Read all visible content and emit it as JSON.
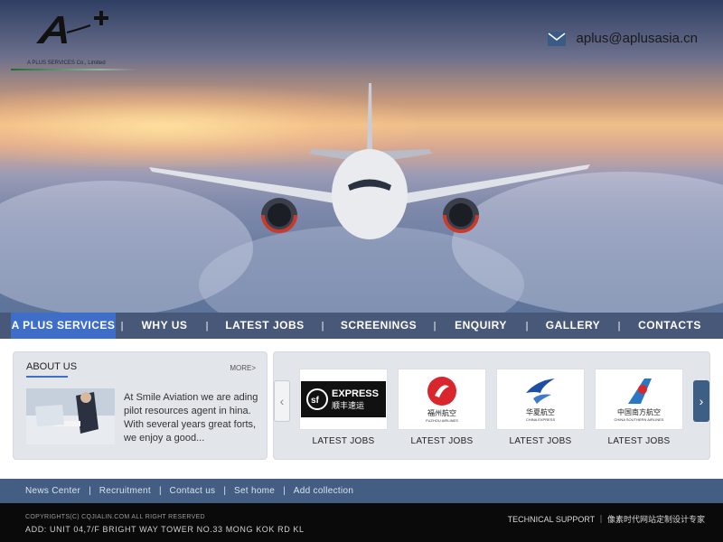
{
  "header": {
    "tagline": "A PLUS SERVICES Co., Limited",
    "email": "aplus@aplusasia.cn",
    "email_icon": "envelope-icon",
    "logo_icon": "a-plus-logo"
  },
  "nav": {
    "items": [
      {
        "label": "A PLUS SERVICES"
      },
      {
        "label": "WHY US"
      },
      {
        "label": "LATEST JOBS"
      },
      {
        "label": "SCREENINGS"
      },
      {
        "label": "ENQUIRY"
      },
      {
        "label": "GALLERY"
      },
      {
        "label": "CONTACTS"
      }
    ],
    "separator": "|"
  },
  "about": {
    "title": "ABOUT US",
    "more": "MORE>",
    "text": "At Smile Aviation we are ading pilot resources agent in hina. With several years great forts, we enjoy a good..."
  },
  "jobs": {
    "prev_icon": "chevron-left-icon",
    "next_icon": "chevron-right-icon",
    "prev_glyph": "‹",
    "next_glyph": "›",
    "items": [
      {
        "label": "LATEST JOBS",
        "logo": "sf-express-logo",
        "en": "EXPRESS",
        "cn": "顺丰速运"
      },
      {
        "label": "LATEST JOBS",
        "logo": "fuzhou-airlines-logo",
        "cn": "福州航空",
        "en": "FUZHOU AIRLINES"
      },
      {
        "label": "LATEST JOBS",
        "logo": "china-express-logo",
        "cn": "华夏航空",
        "en": "CHINA EXPRESS"
      },
      {
        "label": "LATEST JOBS",
        "logo": "china-southern-logo",
        "cn": "中国南方航空",
        "en": "CHINA SOUTHERN AIRLINES"
      }
    ]
  },
  "footer": {
    "links": [
      "News Center",
      "Recruitment",
      "Contact us",
      "Set home",
      "Add collection"
    ],
    "separator": "|",
    "copyright": "COPYRIGHTS(C) CQJIALIN.COM ALL RIGHT RESERVED",
    "address": "ADD: UNIT 04,7/F BRIGHT WAY TOWER NO.33 MONG KOK RD KL",
    "tech": "TECHNICAL SUPPORT ｜ 像素时代网站定制设计专家"
  },
  "colors": {
    "nav_bg": "#384a6e",
    "nav_active": "#3f6ec9",
    "footer_links_bg": "#445d82",
    "bottom_bg": "#0a0a0a"
  }
}
